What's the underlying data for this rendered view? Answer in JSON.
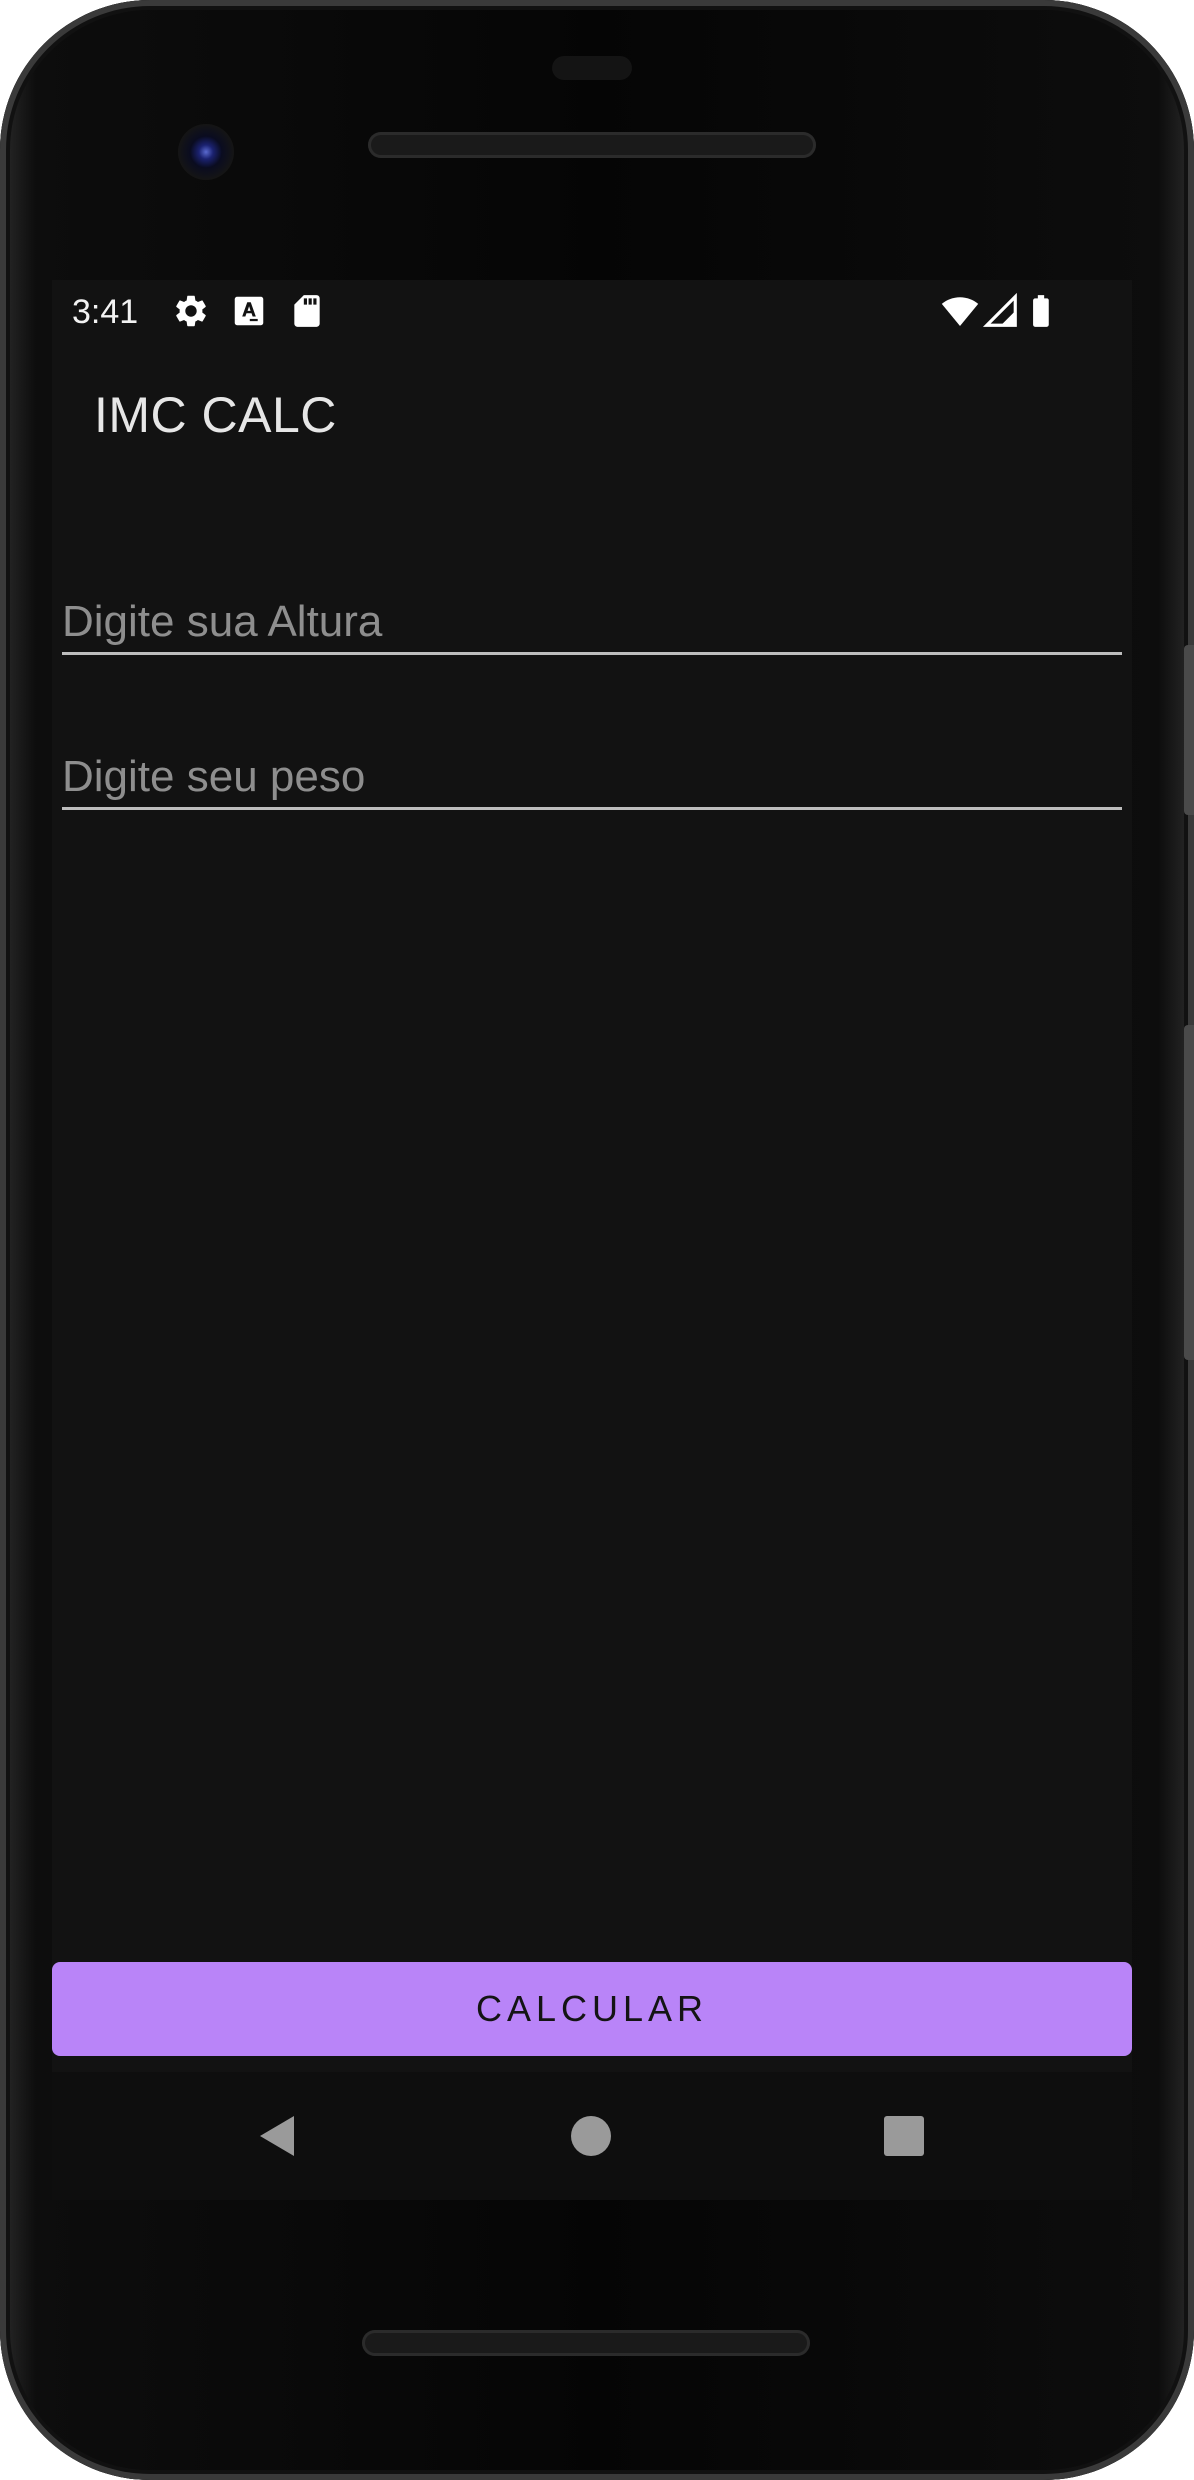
{
  "status_bar": {
    "time": "3:41",
    "left_icons": [
      "settings-icon",
      "font-icon",
      "sd-card-icon"
    ],
    "right_icons": [
      "wifi-icon",
      "cell-signal-icon",
      "battery-icon"
    ]
  },
  "toolbar": {
    "title": "IMC CALC"
  },
  "form": {
    "height": {
      "value": "",
      "placeholder": "Digite sua Altura"
    },
    "weight": {
      "value": "",
      "placeholder": "Digite seu peso"
    }
  },
  "calculate_button": {
    "label": "CALCULAR"
  },
  "navigation": {
    "buttons": [
      "back-icon",
      "home-icon",
      "recents-icon"
    ]
  },
  "colors": {
    "background": "#121212",
    "accent": "#b984f8",
    "text_primary": "#e6e6e6",
    "hint": "#8e8e8e"
  }
}
